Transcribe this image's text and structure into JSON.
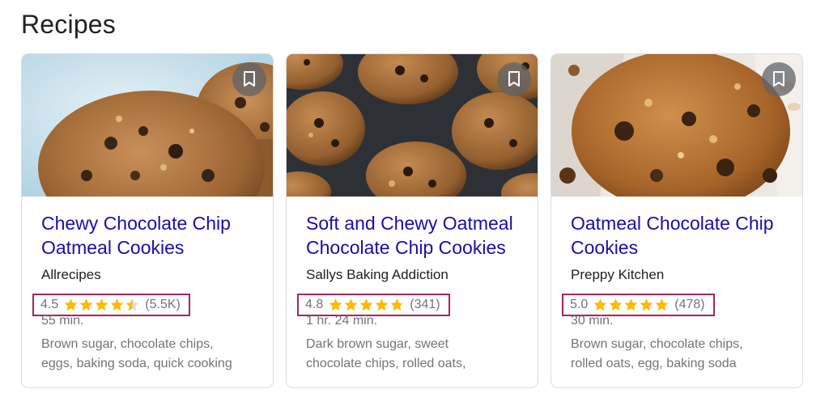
{
  "section": {
    "title": "Recipes"
  },
  "cards": [
    {
      "title_line1": "Chewy Chocolate Chip",
      "title_line2": "Oatmeal Cookies",
      "source": "Allrecipes",
      "rating": "4.5",
      "rating_value": 4.5,
      "reviews": "(5.5K)",
      "time": "55 min.",
      "ingredients_line1": "Brown sugar, chocolate chips,",
      "ingredients_line2": "eggs, baking soda, quick cooking",
      "image_icon": "cookie-photo"
    },
    {
      "title_line1": "Soft and Chewy Oatmeal",
      "title_line2": "Chocolate Chip Cookies",
      "source": "Sallys Baking Addiction",
      "rating": "4.8",
      "rating_value": 4.8,
      "reviews": "(341)",
      "time": "1 hr. 24 min.",
      "ingredients_line1": "Dark brown sugar, sweet",
      "ingredients_line2": "chocolate chips, rolled oats,",
      "image_icon": "cookie-photo"
    },
    {
      "title_line1": "Oatmeal Chocolate Chip",
      "title_line2": "Cookies",
      "source": "Preppy Kitchen",
      "rating": "5.0",
      "rating_value": 5.0,
      "reviews": "(478)",
      "time": "30 min.",
      "ingredients_line1": "Brown sugar, chocolate chips,",
      "ingredients_line2": "rolled oats, egg, baking soda",
      "image_icon": "cookie-photo"
    }
  ],
  "colors": {
    "link": "#1a0dab",
    "star": "#fbbc04",
    "star_empty": "#dadce0",
    "highlight_border": "#a3265a",
    "muted": "#70757a"
  },
  "icons": {
    "bookmark": "bookmark-icon",
    "star": "star-icon"
  }
}
